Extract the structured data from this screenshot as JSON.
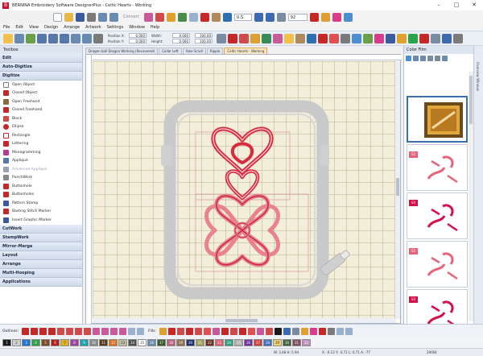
{
  "window": {
    "title": "BERNINA Embroidery Software DesignerPlus - Celtic Hearts - Working",
    "app_logo_letter": "B"
  },
  "qat": {
    "convert_label": "Convert",
    "units_value": "U.S.",
    "zoom_value": "92"
  },
  "menu": [
    "File",
    "Edit",
    "View",
    "Design",
    "Arrange",
    "Artwork",
    "Settings",
    "Window",
    "Help"
  ],
  "position": {
    "x_label": "Position X:",
    "x_value": "0.000",
    "y_label": "Position Y:",
    "y_value": "0.000",
    "w_label": "Width:",
    "w_value": "0.000",
    "h_label": "Height:",
    "h_value": "0.000",
    "w_pct": "100.00",
    "h_pct": "100.00"
  },
  "toolbox": {
    "title": "Toolbox",
    "categories_top": [
      "Edit",
      "Auto-Digitize",
      "Digitize"
    ],
    "tools": [
      {
        "label": "Open Object",
        "icon": "open-object-icon",
        "color": "#7a7a7a",
        "disabled": false
      },
      {
        "label": "Closed Object",
        "icon": "closed-object-icon",
        "color": "#c62828",
        "disabled": false
      },
      {
        "label": "Open Freehand",
        "icon": "open-freehand-icon",
        "color": "#8a6a3a",
        "disabled": false
      },
      {
        "label": "Closed Freehand",
        "icon": "closed-freehand-icon",
        "color": "#c62828",
        "disabled": false
      },
      {
        "label": "Block",
        "icon": "block-icon",
        "color": "#d14a4a",
        "disabled": false
      },
      {
        "label": "Ellipse",
        "icon": "ellipse-icon",
        "color": "#c62828",
        "disabled": false
      },
      {
        "label": "Rectangle",
        "icon": "rectangle-icon",
        "color": "#c62828",
        "disabled": false
      },
      {
        "label": "Lettering",
        "icon": "lettering-icon",
        "color": "#c62828",
        "disabled": false
      },
      {
        "label": "Monogramming",
        "icon": "monogramming-icon",
        "color": "#b83a8a",
        "disabled": false
      },
      {
        "label": "Appliqué",
        "icon": "applique-icon",
        "color": "#5577aa",
        "disabled": false
      },
      {
        "label": "Advanced Appliqué",
        "icon": "advanced-applique-icon",
        "color": "#9aa3b2",
        "disabled": true
      },
      {
        "label": "PunchWork",
        "icon": "punchwork-icon",
        "color": "#888888",
        "disabled": false
      },
      {
        "label": "Buttonhole",
        "icon": "buttonhole-icon",
        "color": "#c62828",
        "disabled": false
      },
      {
        "label": "Buttonholes",
        "icon": "buttonholes-icon",
        "color": "#c62828",
        "disabled": false
      },
      {
        "label": "Pattern Stamp",
        "icon": "pattern-stamp-icon",
        "color": "#3b5aa0",
        "disabled": false
      },
      {
        "label": "Basting Stitch Marker",
        "icon": "basting-marker-icon",
        "color": "#c62828",
        "disabled": false
      },
      {
        "label": "Insert Graphic Marker",
        "icon": "graphic-marker-icon",
        "color": "#3b5aa0",
        "disabled": false
      }
    ],
    "categories_bottom": [
      "CutWork",
      "StampWork",
      "Mirror-Merge",
      "Layout",
      "Arrange",
      "Multi-Hooping",
      "Applications"
    ]
  },
  "tabs": [
    {
      "label": "Dragon ball Dragon Working (Recovered)",
      "active": false
    },
    {
      "label": "Collar Left",
      "active": false
    },
    {
      "label": "Yoke Scroll",
      "active": false
    },
    {
      "label": "Ripple",
      "active": false
    },
    {
      "label": "Celtic Hearts - Working",
      "active": true
    }
  ],
  "colorfilm": {
    "title": "Color Film",
    "overview_label": "Overview Window",
    "items": [
      {
        "badge": "",
        "badge_color": "#ffffff",
        "selected": true
      },
      {
        "badge": "S5",
        "badge_color": "#e8637a",
        "selected": false
      },
      {
        "badge": "S4",
        "badge_color": "#d40f4a",
        "selected": false
      },
      {
        "badge": "S5",
        "badge_color": "#e8637a",
        "selected": false
      },
      {
        "badge": "S4",
        "badge_color": "#d40f4a",
        "selected": false
      }
    ]
  },
  "bottom": {
    "outlines_label": "Outlines:",
    "fills_label": "Fills:"
  },
  "palette": [
    {
      "label": "1",
      "color": "#1a1a1a"
    },
    {
      "label": "2",
      "color": "#d0d0d0"
    },
    {
      "label": "3",
      "color": "#1f77d0"
    },
    {
      "label": "4",
      "color": "#2aa34a"
    },
    {
      "label": "5",
      "color": "#7a4a2a"
    },
    {
      "label": "6",
      "color": "#b31f1f"
    },
    {
      "label": "7",
      "color": "#e0b020"
    },
    {
      "label": "8",
      "color": "#a040a0"
    },
    {
      "label": "9",
      "color": "#1aa3b3"
    },
    {
      "label": "10",
      "color": "#8a8a8a"
    },
    {
      "label": "11",
      "color": "#5a3a1a"
    },
    {
      "label": "12",
      "color": "#e07020"
    },
    {
      "label": "13",
      "color": "#c0c0a0"
    },
    {
      "label": "14",
      "color": "#505050"
    },
    {
      "label": "15",
      "color": "#ffffff"
    },
    {
      "label": "16",
      "color": "#6a8ab0"
    },
    {
      "label": "17",
      "color": "#3a5a2a"
    },
    {
      "label": "18",
      "color": "#c06080"
    },
    {
      "label": "19",
      "color": "#907050"
    },
    {
      "label": "20",
      "color": "#203070"
    },
    {
      "label": "21",
      "color": "#a0a060"
    },
    {
      "label": "22",
      "color": "#703020"
    },
    {
      "label": "23",
      "color": "#e06070"
    },
    {
      "label": "24",
      "color": "#30a080"
    },
    {
      "label": "25",
      "color": "#b0b0b0"
    },
    {
      "label": "26",
      "color": "#7030a0"
    },
    {
      "label": "27",
      "color": "#d04040"
    },
    {
      "label": "28",
      "color": "#4070c0"
    },
    {
      "label": "29",
      "color": "#f0d070"
    },
    {
      "label": "30",
      "color": "#406040"
    },
    {
      "label": "31",
      "color": "#805060"
    },
    {
      "label": "32",
      "color": "#c090c0"
    }
  ],
  "status": {
    "stitches": "W: 3.48 H: 5.94",
    "coords": "X: -0.13 Y: -0.71 L: 0.71 A: -77",
    "count": "29004"
  },
  "colors": {
    "accent": "#3a6fb0",
    "design_red": "#d62c3f",
    "design_pink": "#e8828f"
  }
}
